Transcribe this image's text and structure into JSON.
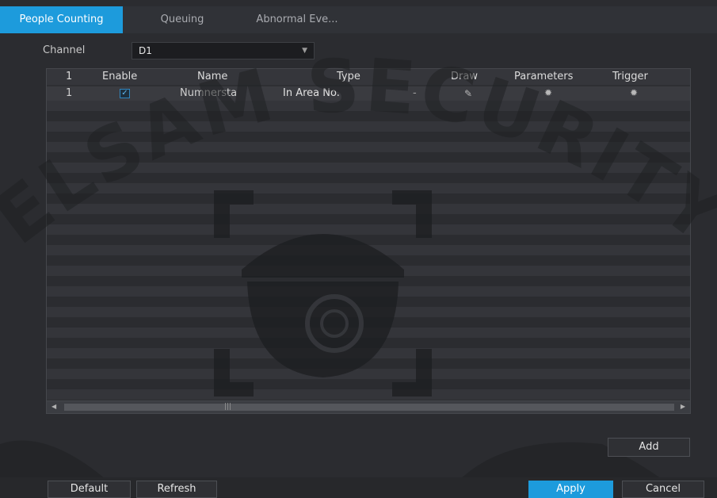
{
  "tabs": [
    {
      "label": "People Counting",
      "active": true
    },
    {
      "label": "Queuing",
      "active": false
    },
    {
      "label": "Abnormal Eve...",
      "active": false
    }
  ],
  "channel": {
    "label": "Channel",
    "value": "D1"
  },
  "table": {
    "headers": {
      "index": "1",
      "enable": "Enable",
      "name": "Name",
      "type": "Type",
      "draw": "Draw",
      "parameters": "Parameters",
      "trigger": "Trigger"
    },
    "rows": [
      {
        "index": "1",
        "enabled": true,
        "name": "Numnersta",
        "type": "In Area No.",
        "extra": "-"
      }
    ]
  },
  "watermark": {
    "text": "ELSAM SECURITY"
  },
  "buttons": {
    "add": "Add",
    "default": "Default",
    "refresh": "Refresh",
    "apply": "Apply",
    "cancel": "Cancel"
  },
  "colors": {
    "accent": "#1d9bdc",
    "background": "#2b2c30"
  }
}
